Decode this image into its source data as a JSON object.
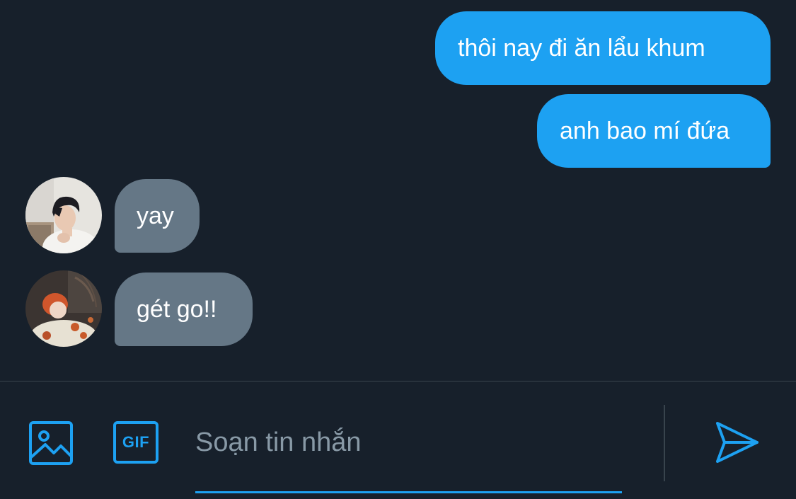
{
  "conversation": {
    "messages": [
      {
        "direction": "outgoing",
        "text": "thôi nay đi ăn lẩu khum"
      },
      {
        "direction": "outgoing",
        "text": "anh bao mí đứa"
      },
      {
        "direction": "incoming",
        "sender_avatar": "avatar-dark-hair-person",
        "text": "yay"
      },
      {
        "direction": "incoming",
        "sender_avatar": "avatar-orange-hair-person",
        "text": "gét go!!"
      }
    ]
  },
  "composer": {
    "placeholder": "Soạn tin nhắn",
    "value": "",
    "media_button_icon": "image-icon",
    "gif_button_label": "GIF",
    "send_button_icon": "send-icon"
  },
  "colors": {
    "background": "#17202b",
    "outgoing_bubble": "#1da1f2",
    "incoming_bubble": "#657786",
    "accent": "#1da1f2",
    "divider": "#38444d",
    "placeholder": "#8899a6"
  }
}
